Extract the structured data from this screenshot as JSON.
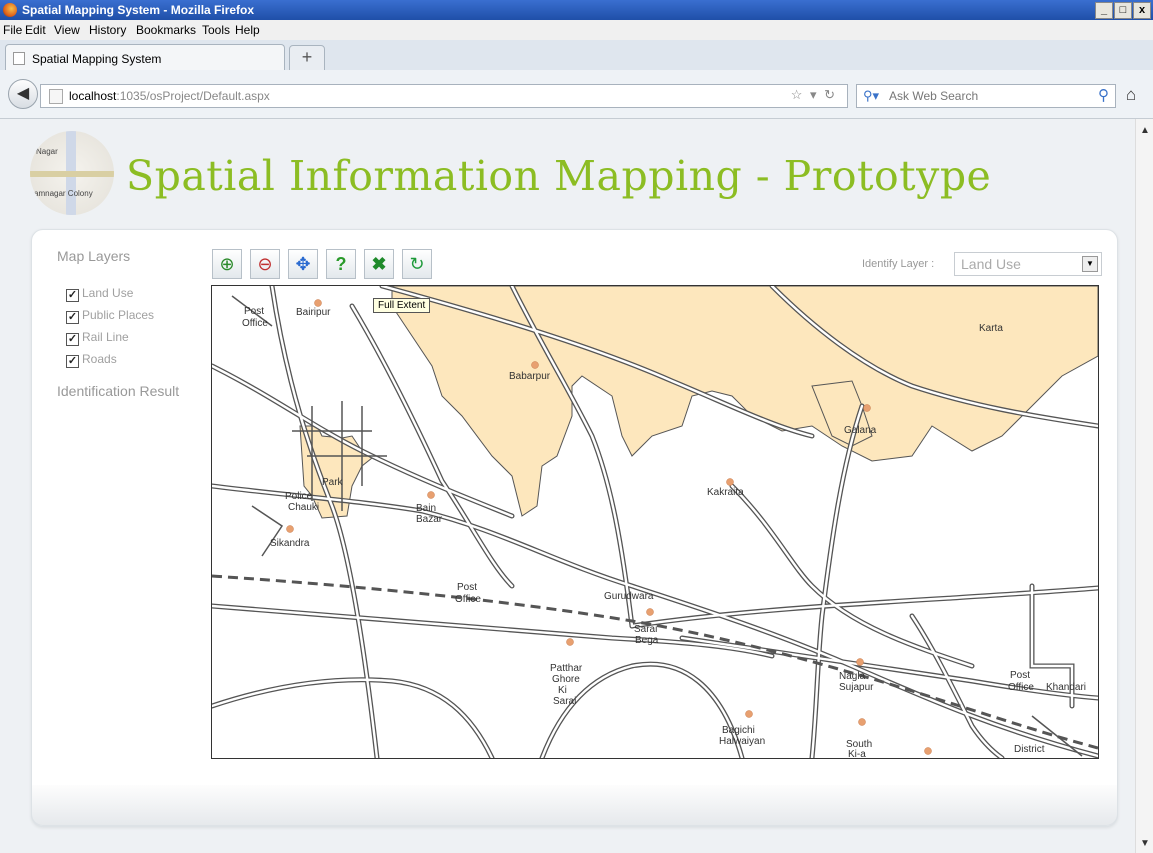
{
  "window": {
    "title": "Spatial Mapping System - Mozilla Firefox",
    "controls": [
      "_",
      "□",
      "x"
    ]
  },
  "menu": [
    "File",
    "Edit",
    "View",
    "History",
    "Bookmarks",
    "Tools",
    "Help"
  ],
  "tab": {
    "label": "Spatial Mapping System",
    "new_tab": "+"
  },
  "nav": {
    "url_host": "localhost",
    "url_path": ":1035/osProject/Default.aspx",
    "search_placeholder": "Ask Web Search"
  },
  "page": {
    "title": "Spatial Information Mapping - Prototype",
    "logo_text_top": "Nagar",
    "logo_text_bottom": "amnagar Colony"
  },
  "sidebar": {
    "heading": "Map Layers",
    "layers": [
      {
        "label": "Land Use",
        "checked": true
      },
      {
        "label": "Public Places",
        "checked": true
      },
      {
        "label": "Rail Line",
        "checked": true
      },
      {
        "label": "Roads",
        "checked": true
      }
    ],
    "identification_heading": "Identification Result"
  },
  "toolbar": {
    "tools": [
      {
        "name": "zoom-in",
        "icon": "zoom-in-icon"
      },
      {
        "name": "zoom-out",
        "icon": "zoom-out-icon"
      },
      {
        "name": "pan",
        "icon": "pan-icon"
      },
      {
        "name": "identify",
        "icon": "help-icon"
      },
      {
        "name": "full-extent",
        "icon": "full-extent-icon"
      },
      {
        "name": "refresh",
        "icon": "refresh-icon"
      }
    ],
    "tooltip": "Full Extent"
  },
  "identify": {
    "label": "Identify Layer :",
    "selected": "Land Use"
  },
  "map": {
    "places": [
      {
        "label": "Post"
      },
      {
        "label": "Office"
      },
      {
        "label": "Bairipur"
      },
      {
        "label": "Babarpur"
      },
      {
        "label": "Galana"
      },
      {
        "label": "Karta"
      },
      {
        "label": "Kakraita"
      },
      {
        "label": "Park"
      },
      {
        "label": "Police"
      },
      {
        "label": "Chauki"
      },
      {
        "label": "Sikandra"
      },
      {
        "label": "Bain"
      },
      {
        "label": "Bazar"
      },
      {
        "label": "Post"
      },
      {
        "label": "Office"
      },
      {
        "label": "Gurudwara"
      },
      {
        "label": "Sarai"
      },
      {
        "label": "Bega"
      },
      {
        "label": "Patthar"
      },
      {
        "label": "Ghore"
      },
      {
        "label": "Ki"
      },
      {
        "label": "Sarai"
      },
      {
        "label": "Nagla"
      },
      {
        "label": "Sujapur"
      },
      {
        "label": "Post"
      },
      {
        "label": "Office"
      },
      {
        "label": "Khandari"
      },
      {
        "label": "Bagichi"
      },
      {
        "label": "Halwaiyan"
      },
      {
        "label": "South"
      },
      {
        "label": "Ki-a"
      },
      {
        "label": "District"
      }
    ],
    "land_use_color": "#fde7bd"
  }
}
